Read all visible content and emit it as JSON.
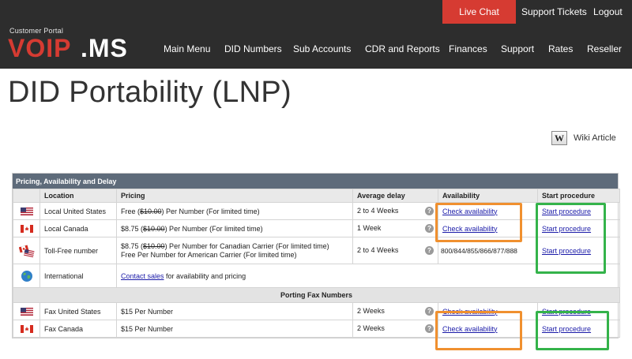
{
  "header": {
    "portal_label": "Customer Portal",
    "logo_text": "VoIP.ms",
    "live_chat": "Live Chat",
    "support_tickets": "Support Tickets",
    "logout": "Logout",
    "nav": [
      "Main Menu",
      "DID Numbers",
      "Sub Accounts",
      "CDR and Reports",
      "Finances",
      "Support",
      "Rates",
      "Reseller"
    ],
    "accent_color": "#d63b32"
  },
  "page": {
    "title": "DID Portability (LNP)",
    "wiki_icon_letter": "W",
    "wiki_label": "Wiki Article"
  },
  "table": {
    "caption": "Pricing, Availability and Delay",
    "columns": [
      "Location",
      "Pricing",
      "Average delay",
      "Availability",
      "Start procedure"
    ],
    "rows": [
      {
        "flag": "us-flag-icon",
        "location": "Local United States",
        "pricing_pre": "Free (",
        "pricing_strike": "$10.00",
        "pricing_post": ") Per Number (For limited time)",
        "delay": "2 to 4 Weeks",
        "availability": "Check availability",
        "procedure": "Start procedure"
      },
      {
        "flag": "canada-flag-icon",
        "location": "Local Canada",
        "pricing_pre": "$8.75 (",
        "pricing_strike": "$10.00",
        "pricing_post": ") Per Number (For limited time)",
        "delay": "1 Week",
        "availability": "Check availability",
        "procedure": "Start procedure"
      },
      {
        "flag": "toll-free-flags-icon",
        "location": "Toll-Free number",
        "pricing_pre": "$8.75 (",
        "pricing_strike": "$10.00",
        "pricing_post": ") Per Number for Canadian Carrier (For limited time)",
        "pricing_line2": "Free Per Number for American Carrier (For limited time)",
        "delay": "2 to 4 Weeks",
        "availability": "800/844/855/866/877/888",
        "procedure": "Start procedure"
      },
      {
        "flag": "globe-icon",
        "location": "International",
        "contact_link": "Contact sales",
        "contact_rest": " for availability and pricing"
      }
    ],
    "section_fax": "Porting Fax Numbers",
    "fax_rows": [
      {
        "flag": "us-flag-icon",
        "location": "Fax United States",
        "pricing": "$15 Per Number",
        "delay": "2 Weeks",
        "availability": "Check availability",
        "procedure": "Start procedure"
      },
      {
        "flag": "canada-flag-icon",
        "location": "Fax Canada",
        "pricing": "$15 Per Number",
        "delay": "2 Weeks",
        "availability": "Check availability",
        "procedure": "Start procedure"
      }
    ],
    "help_glyph": "?"
  },
  "highlight_colors": {
    "availability": "#f0902f",
    "procedure": "#34b34a"
  }
}
